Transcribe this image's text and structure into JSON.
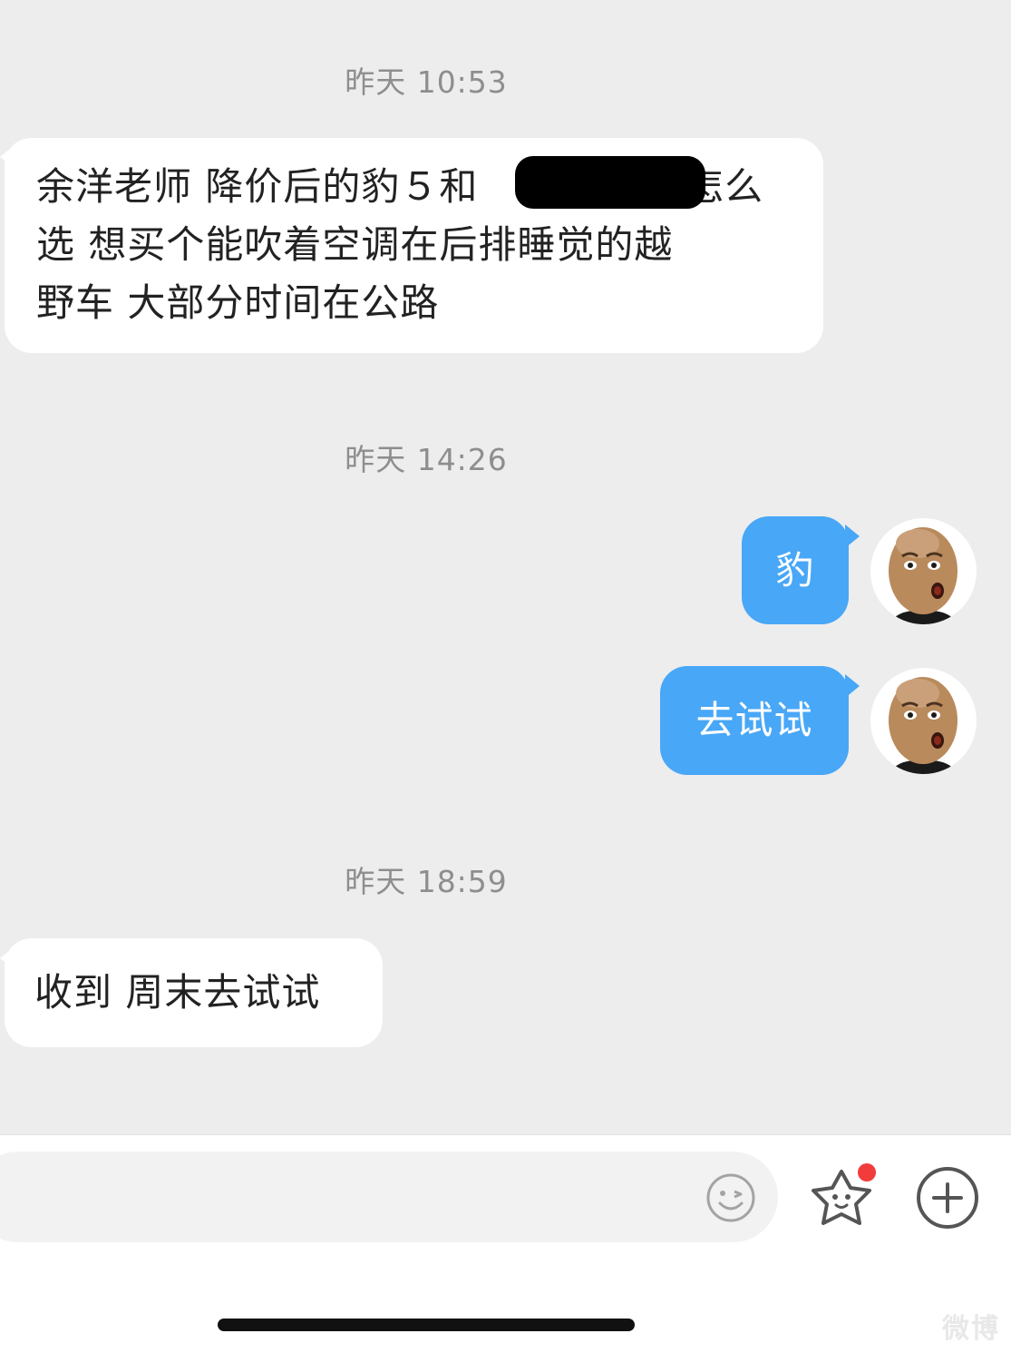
{
  "colors": {
    "chat_background": "#ededed",
    "incoming_bubble": "#ffffff",
    "outgoing_bubble": "#48a7f7",
    "timestamp_text": "#8e8e8e",
    "notification_dot": "#f23c3c"
  },
  "messages": [
    {
      "type": "timestamp",
      "text": "昨天 10:53"
    },
    {
      "type": "incoming",
      "lines": [
        "余洋老师 降价后的豹５和",
        "选  想买个能吹着空调在后排睡觉的越",
        "野车 大部分时间在公路"
      ],
      "line1_suffix": "怎么",
      "redacted": true
    },
    {
      "type": "timestamp",
      "text": "昨天 14:26"
    },
    {
      "type": "outgoing",
      "text": "豹",
      "avatar": "bald-man-avatar"
    },
    {
      "type": "outgoing",
      "text": "去试试",
      "avatar": "bald-man-avatar"
    },
    {
      "type": "timestamp",
      "text": "昨天 18:59"
    },
    {
      "type": "incoming",
      "text": "收到 周末去试试"
    }
  ],
  "toolbar": {
    "input_placeholder": "",
    "icons": [
      "emoji-icon",
      "star-sticker-icon",
      "plus-icon"
    ],
    "star_has_notification": true
  },
  "watermark": {
    "text": "微博"
  }
}
